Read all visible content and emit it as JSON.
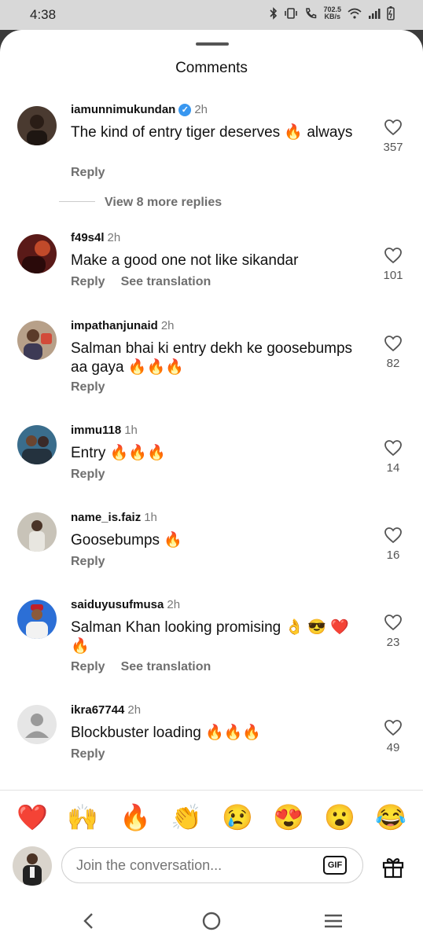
{
  "status_bar": {
    "time": "4:38",
    "net_speed_value": "702.5",
    "net_speed_unit": "KB/s"
  },
  "sheet": {
    "title": "Comments"
  },
  "comments": [
    {
      "username": "iamunnimukundan",
      "verified": true,
      "time": "2h",
      "text": "The kind of entry tiger deserves 🔥 always",
      "actions": [
        "Reply"
      ],
      "likes": "357",
      "view_more": "View 8 more replies",
      "avatar_color": "#4a3a30"
    },
    {
      "username": "f49s4l",
      "time": "2h",
      "text": "Make a good one not like sikandar",
      "actions": [
        "Reply",
        "See translation"
      ],
      "likes": "101",
      "avatar_color": "#5a1a18"
    },
    {
      "username": "impathanjunaid",
      "time": "2h",
      "text": "Salman bhai ki entry dekh ke goosebumps aa gaya 🔥🔥🔥",
      "actions": [
        "Reply"
      ],
      "likes": "82",
      "avatar_color": "#b7a089"
    },
    {
      "username": "immu118",
      "time": "1h",
      "text": "Entry 🔥🔥🔥",
      "actions": [
        "Reply"
      ],
      "likes": "14",
      "avatar_color": "#3a6d8c"
    },
    {
      "username": "name_is.faiz",
      "time": "1h",
      "text": "Goosebumps 🔥",
      "actions": [
        "Reply"
      ],
      "likes": "16",
      "avatar_color": "#c8c3b8"
    },
    {
      "username": "saiduyusufmusa",
      "time": "2h",
      "text": "Salman Khan looking promising 👌 😎 ❤️ 🔥",
      "actions": [
        "Reply",
        "See translation"
      ],
      "likes": "23",
      "avatar_color": "#2c6fd6"
    },
    {
      "username": "ikra67744",
      "time": "2h",
      "text": "Blockbuster loading 🔥🔥🔥",
      "actions": [
        "Reply"
      ],
      "likes": "49",
      "avatar_color": "#dcdcdc"
    }
  ],
  "emoji_bar": [
    "❤️",
    "🙌",
    "🔥",
    "👏",
    "😢",
    "😍",
    "😮",
    "😂"
  ],
  "composer": {
    "placeholder": "Join the conversation...",
    "gif_label": "GIF"
  },
  "icons": {
    "like": "heart-outline-icon",
    "gift": "gift-icon",
    "back": "nav-back-icon",
    "home": "nav-home-icon",
    "recents": "nav-recents-icon"
  },
  "colors": {
    "verified": "#3897f0",
    "muted_text": "#6f6f6f"
  }
}
